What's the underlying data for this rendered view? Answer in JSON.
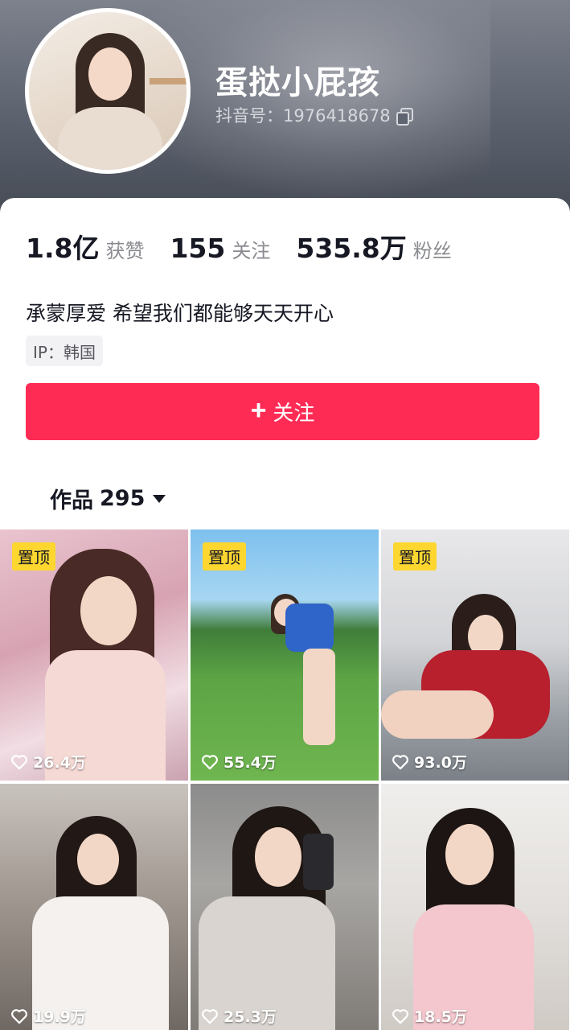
{
  "profile": {
    "nickname": "蛋挞小屁孩",
    "douyin_id": "抖音号：1976418678"
  },
  "stats": [
    {
      "value": "1.8亿",
      "label": "获赞"
    },
    {
      "value": "155",
      "label": "关注"
    },
    {
      "value": "535.8万",
      "label": "粉丝"
    }
  ],
  "bio": "承蒙厚爱 希望我们都能够天天开心",
  "ip": "IP：韩国",
  "follow_button": {
    "label": "关注"
  },
  "works_tab": {
    "label": "作品",
    "count": "295"
  },
  "videos": [
    {
      "likes": "26.4万",
      "pinned_label": "置顶"
    },
    {
      "likes": "55.4万",
      "pinned_label": "置顶"
    },
    {
      "likes": "93.0万",
      "pinned_label": "置顶"
    },
    {
      "likes": "19.9万"
    },
    {
      "likes": "25.3万"
    },
    {
      "likes": "18.5万"
    }
  ],
  "colors": {
    "accent": "#fe2c55",
    "pin": "#fdd630"
  }
}
